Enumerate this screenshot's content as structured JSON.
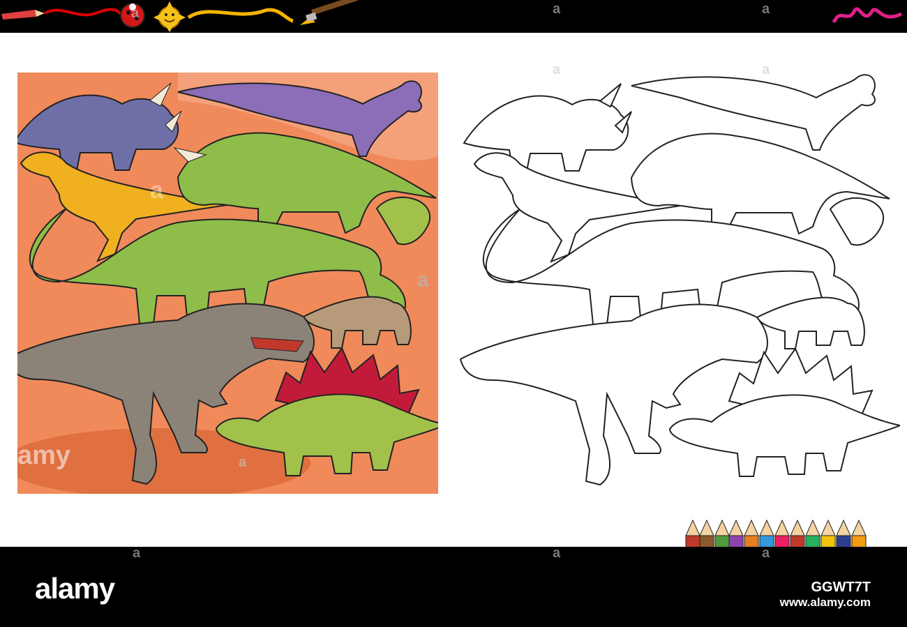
{
  "watermark": {
    "brand": "alamy",
    "image_id": "GGWT7T",
    "site": "www.alamy.com",
    "overlay_a": "a",
    "overlay_amy": "amy"
  },
  "icons": [
    "pencil-icon",
    "ladybug-icon",
    "sun-icon",
    "paintbrush-icon",
    "pink-scribble-icon",
    "colored-pencils-icon"
  ],
  "colors": {
    "panel_bg": "#f08a5a",
    "triceratops_blue": "#6f6fa8",
    "sauropod_green": "#8fbd4a",
    "trex_gray": "#8c8378",
    "stegosaurus_green": "#a2c14b",
    "plates_red": "#c21b3a",
    "lambeosaurus_purple": "#8c6db8",
    "allosaurus_yellow": "#f0b020"
  }
}
